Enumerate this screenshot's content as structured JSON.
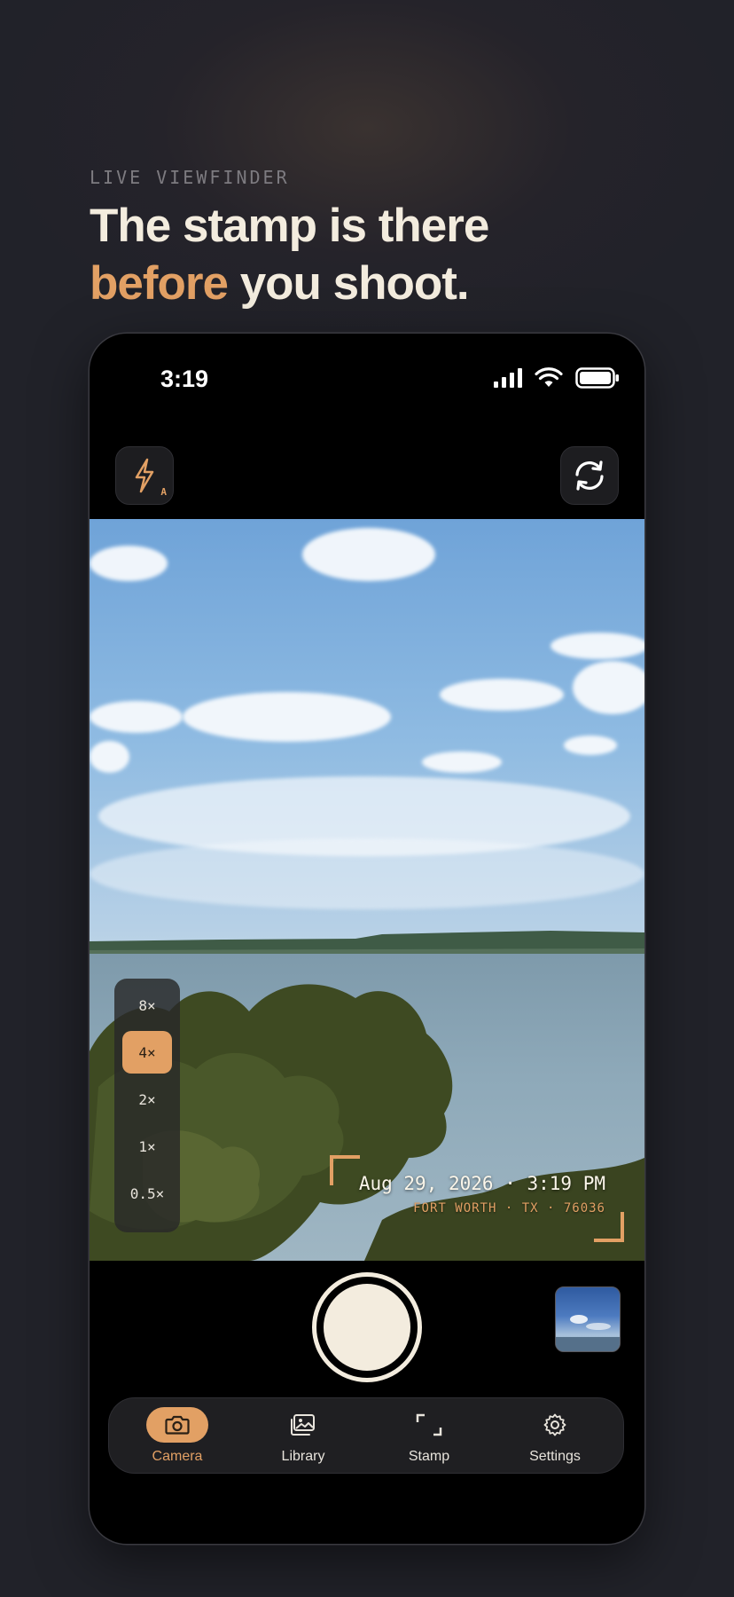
{
  "hero": {
    "eyebrow": "LIVE VIEWFINDER",
    "headline_line1": "The stamp is there",
    "headline_accent": "before",
    "headline_rest": " you shoot."
  },
  "status_bar": {
    "time": "3:19",
    "icons": [
      "signal-icon",
      "wifi-icon",
      "battery-icon"
    ]
  },
  "camera_controls": {
    "flash_mode": "A",
    "flash_icon": "flash-icon",
    "flip_icon": "flip-camera-icon"
  },
  "zoom": {
    "levels": [
      "8×",
      "4×",
      "2×",
      "1×",
      "0.5×"
    ],
    "selected": "4×"
  },
  "stamp": {
    "date_time": "Aug 29, 2026 · 3:19 PM",
    "location": "FORT WORTH · TX · 76036"
  },
  "tabs": [
    {
      "label": "Camera",
      "icon": "camera-icon",
      "active": true
    },
    {
      "label": "Library",
      "icon": "photos-icon",
      "active": false
    },
    {
      "label": "Stamp",
      "icon": "stamp-frame-icon",
      "active": false
    },
    {
      "label": "Settings",
      "icon": "gear-icon",
      "active": false
    }
  ],
  "colors": {
    "accent": "#e2a064",
    "background": "#212229",
    "text": "#f3ecde"
  }
}
